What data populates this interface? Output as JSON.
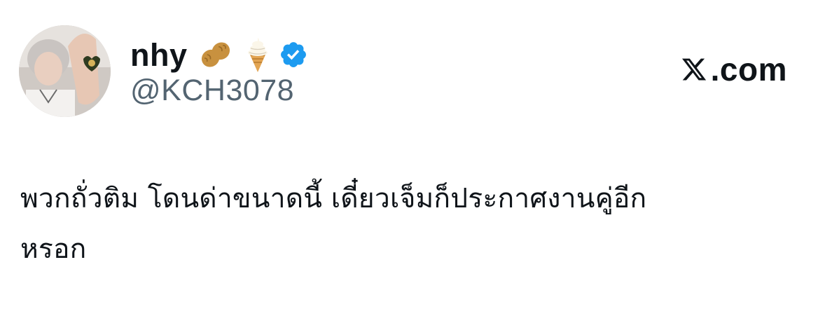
{
  "author": {
    "display_name": "nhy",
    "handle": "@KCH3078",
    "name_emojis": [
      "peanut-icon",
      "soft-ice-cream-icon"
    ],
    "verified": true,
    "verified_color": "#1d9bf0"
  },
  "source": {
    "domain": ".com",
    "logo": "x-logo-icon"
  },
  "tweet": {
    "line1": "พวกถั่วติม โดนด่าขนาดนี้ เดี๋ยวเจ็มก็ประกาศงานคู่อีก",
    "line2": "หรอก"
  },
  "colors": {
    "text": "#0f1419",
    "secondary_text": "#536471",
    "background": "#ffffff"
  }
}
